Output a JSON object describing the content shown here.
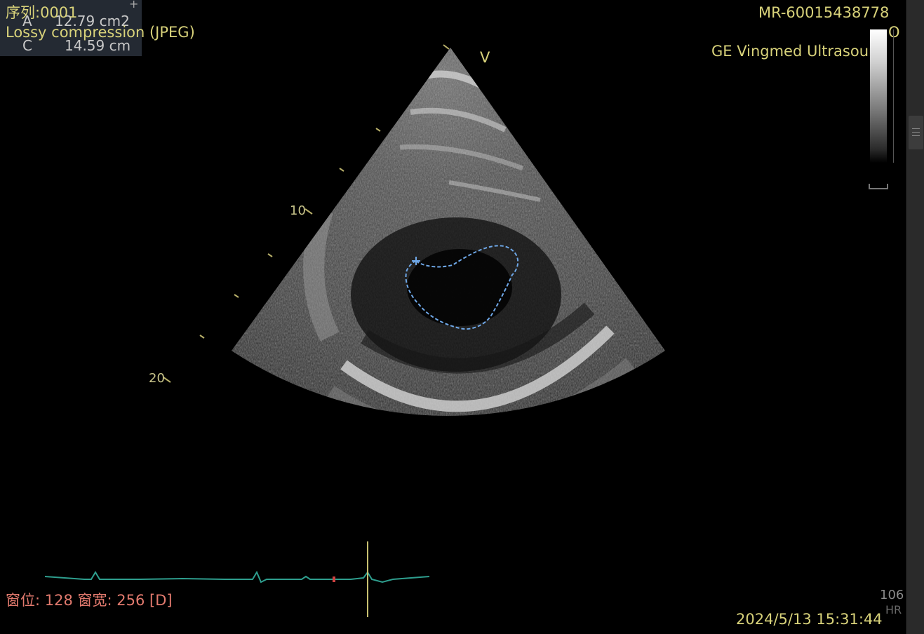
{
  "overlay": {
    "series": "序列:0001",
    "compression": "Lossy compression (JPEG)",
    "patient_id": "MR-60015438778",
    "manufacturer": "GE Vingmed Ultrasound",
    "orientation_marker": "V",
    "orientation_letter": "O",
    "timestamp": "2024/5/13 15:31:44"
  },
  "measurement": {
    "area_label": "A",
    "area_value": "12.79 cm2",
    "circ_label": "C",
    "circ_value": "14.59 cm"
  },
  "depth_scale": {
    "mark_10": "10",
    "mark_20": "20"
  },
  "window": {
    "text": "窗位: 128 窗宽: 256 [D]"
  },
  "heart_rate": {
    "value": "106",
    "label": "HR"
  },
  "colors": {
    "overlay_text": "#d8d27a",
    "window_text": "#e27a6e",
    "trace": "#6fa8e8",
    "ecg": "#2e9e8e"
  }
}
